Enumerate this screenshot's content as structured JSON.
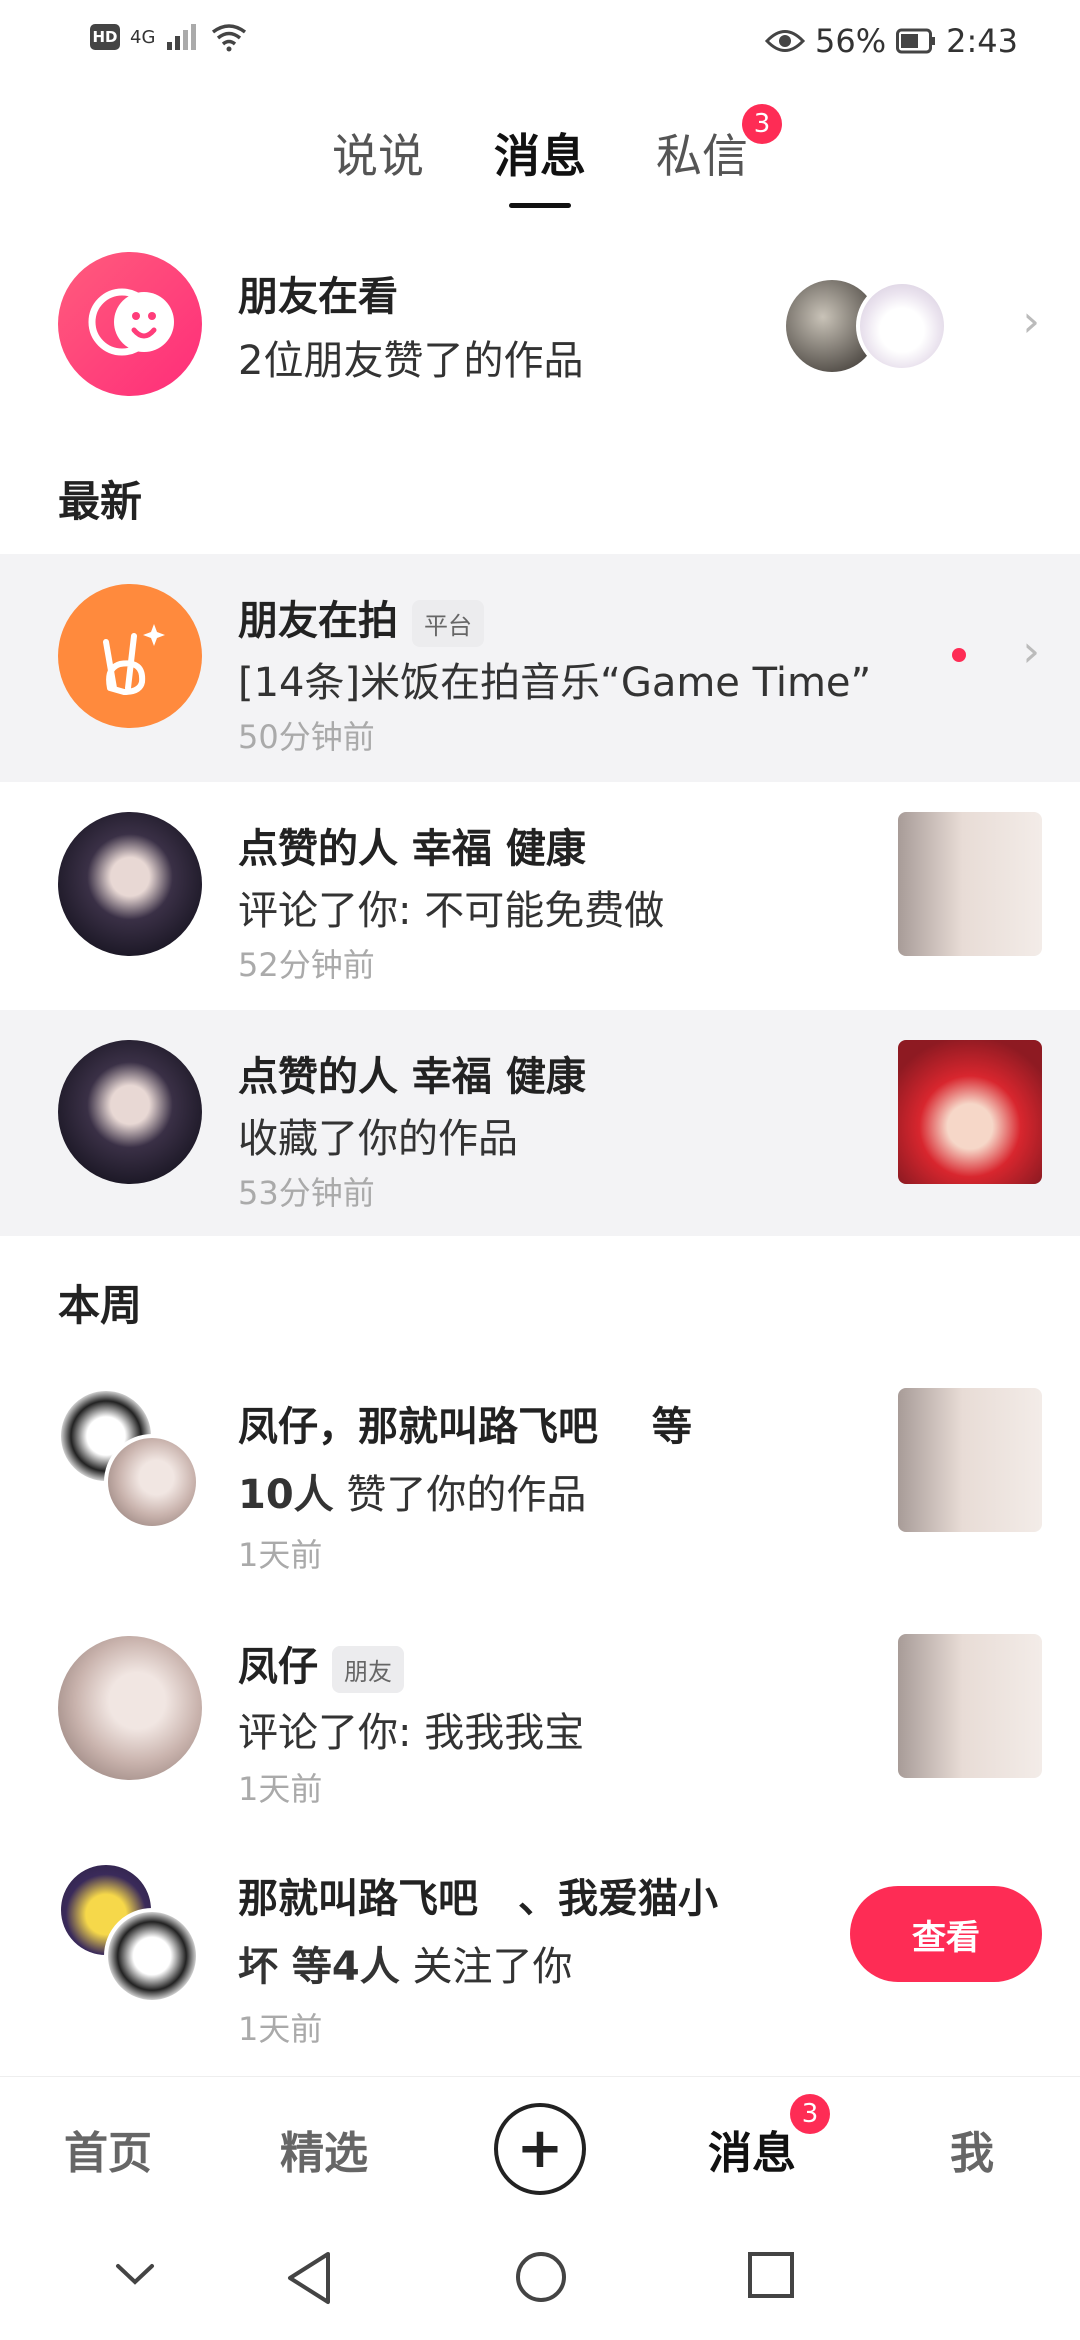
{
  "status_bar": {
    "hd": "HD",
    "network": "4G",
    "battery": "56%",
    "time": "2:43"
  },
  "tabs": [
    {
      "label": "说说"
    },
    {
      "label": "消息"
    },
    {
      "label": "私信",
      "badge": "3"
    }
  ],
  "friends_watching": {
    "title": "朋友在看",
    "subtitle": "2位朋友赞了的作品"
  },
  "sections": {
    "latest": "最新",
    "this_week": "本周"
  },
  "notifications": [
    {
      "title": "朋友在拍",
      "tag": "平台",
      "text": "[14条]米饭在拍音乐“Game Time”",
      "time": "50分钟前"
    },
    {
      "title": "点赞的人 幸福 健康",
      "text": "评论了你: 不可能免费做",
      "time": "52分钟前"
    },
    {
      "title": "点赞的人 幸福 健康",
      "text": "收藏了你的作品",
      "time": "53分钟前"
    },
    {
      "title": "凤仔，那就叫路飞吧　 等",
      "bold": "10人",
      "text": " 赞了你的作品",
      "time": "1天前"
    },
    {
      "title": "凤仔",
      "tag": "朋友",
      "text": "评论了你: 我我我宝",
      "time": "1天前"
    },
    {
      "title": "那就叫路飞吧　、我爱猫小",
      "bold": "坏 等4人",
      "text": " 关注了你",
      "time": "1天前",
      "button": "查看"
    }
  ],
  "bottom_nav": {
    "home": "首页",
    "featured": "精选",
    "messages": "消息",
    "messages_badge": "3",
    "me": "我"
  },
  "colors": {
    "accent": "#fe2c55",
    "shaded_row": "#f3f3f5"
  }
}
